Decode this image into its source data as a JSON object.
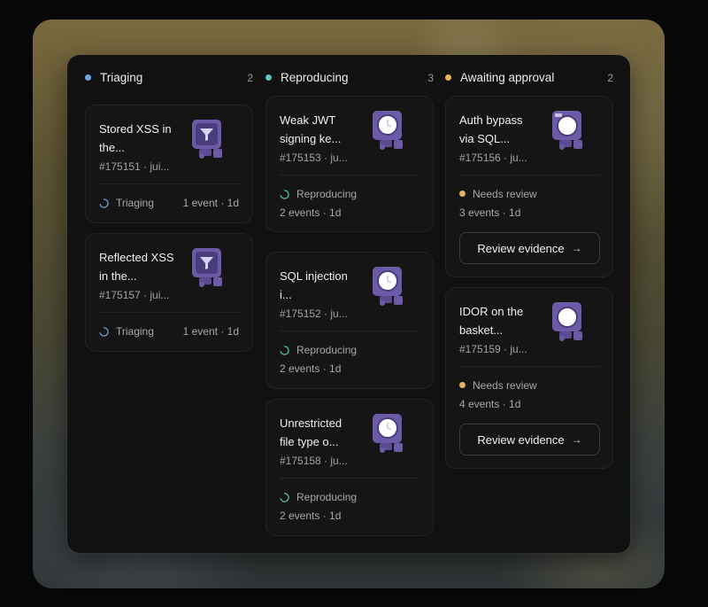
{
  "colors": {
    "triaging": "#6fa3e0",
    "reproducing": "#5cc4c2",
    "awaiting": "#e8b35a",
    "robot_body": "#6c5aa6",
    "robot_dark": "#4a3d7d"
  },
  "columns": [
    {
      "title": "Triaging",
      "count": "2",
      "cards": [
        {
          "title": "Stored XSS in the...",
          "meta": "#175151 · jui...",
          "status": "Triaging",
          "summary": "1 event · 1d",
          "icon": "robot-icon-funnel"
        },
        {
          "title": "Reflected XSS in the...",
          "meta": "#175157 · jui...",
          "status": "Triaging",
          "summary": "1 event · 1d",
          "icon": "robot-icon-funnel"
        }
      ]
    },
    {
      "title": "Reproducing",
      "count": "3",
      "cards": [
        {
          "title": "Weak JWT signing ke...",
          "meta": "#175153 · ju...",
          "status": "Reproducing",
          "summary": "2 events · 1d",
          "icon": "robot-icon-clock"
        },
        {
          "title": "SQL injection i...",
          "meta": "#175152 · ju...",
          "status": "Reproducing",
          "summary": "2 events · 1d",
          "icon": "robot-icon-clock"
        },
        {
          "title": "Unrestricted file type o...",
          "meta": "#175158 · ju...",
          "status": "Reproducing",
          "summary": "2 events · 1d",
          "icon": "robot-icon-clock"
        }
      ]
    },
    {
      "title": "Awaiting approval",
      "count": "2",
      "cards": [
        {
          "title": "Auth bypass via SQL...",
          "meta": "#175156 · ju...",
          "status": "Needs review",
          "summary": "3 events · 1d",
          "button": "Review evidence",
          "button_icon": "arrow-right-icon",
          "icon": "robot-icon-face"
        },
        {
          "title": "IDOR on the basket...",
          "meta": "#175159 · ju...",
          "status": "Needs review",
          "summary": "4 events · 1d",
          "button": "Review evidence",
          "button_icon": "arrow-right-icon",
          "icon": "robot-icon-face"
        }
      ]
    }
  ]
}
